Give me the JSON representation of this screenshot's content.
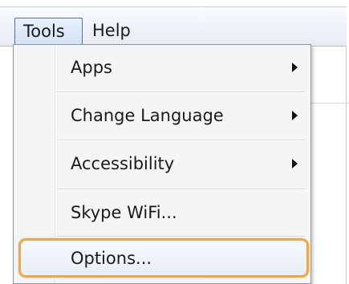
{
  "menubar": {
    "items": [
      {
        "label": "Tools"
      },
      {
        "label": "Help"
      }
    ]
  },
  "tools_menu": {
    "items": [
      {
        "label": "Apps",
        "has_submenu": true
      },
      {
        "label": "Change Language",
        "has_submenu": true
      },
      {
        "label": "Accessibility",
        "has_submenu": true
      },
      {
        "label": "Skype WiFi...",
        "has_submenu": false
      },
      {
        "label": "Options...",
        "has_submenu": false,
        "highlighted": true
      }
    ]
  },
  "colors": {
    "highlight_ring": "#f0a742",
    "menubar_active_border": "#5f6f87"
  }
}
